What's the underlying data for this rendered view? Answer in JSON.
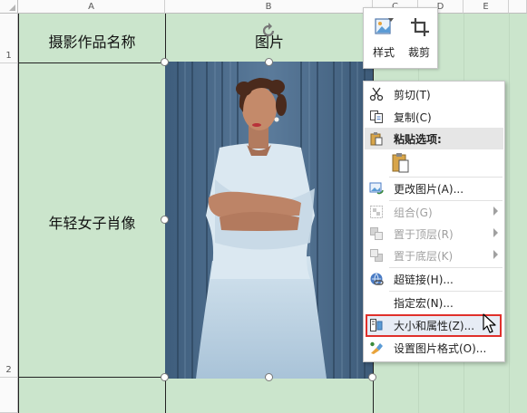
{
  "columns": [
    "A",
    "B",
    "C",
    "D",
    "E"
  ],
  "rows": [
    "1",
    "2"
  ],
  "cells": {
    "a1": "摄影作品名称",
    "b1": "图片",
    "a2": "年轻女子肖像"
  },
  "mini_toolbar": {
    "style_label": "样式",
    "crop_label": "裁剪"
  },
  "context_menu": {
    "cut": "剪切(T)",
    "copy": "复制(C)",
    "paste_options": "粘贴选项:",
    "change_picture": "更改图片(A)...",
    "group": "组合(G)",
    "bring_to_front": "置于顶层(R)",
    "send_to_back": "置于底层(K)",
    "hyperlink": "超链接(H)...",
    "assign_macro": "指定宏(N)...",
    "size_properties": "大小和属性(Z)...",
    "format_picture": "设置图片格式(O)..."
  },
  "colors": {
    "sheet_bg": "#cbe5cc",
    "highlight_border": "#e0302b",
    "photo_bg": "#4f6e8d",
    "dress": "#c4d8e6"
  }
}
